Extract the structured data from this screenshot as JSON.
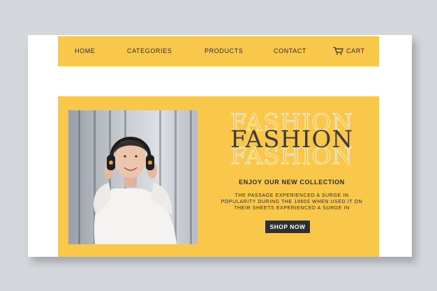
{
  "nav": {
    "home": "HOME",
    "categories": "CATEGORIES",
    "products": "PRODUCTS",
    "contact": "CONTACT",
    "cart": "CART"
  },
  "hero": {
    "title": "FASHION",
    "subtitle": "ENJOY OUR NEW COLLECTION",
    "body": "THE PASSAGE EXPERIENCED A SURGE IN POPULARITY DURING THE 1960S WHEN USED IT ON THEIR SHEETS EXPERIENCED A SURGE IN",
    "cta": "SHOP NOW"
  },
  "colors": {
    "accent": "#f9c74a",
    "dark": "#2f3033",
    "background": "#d3d6db"
  },
  "icons": {
    "cart": "cart-icon"
  }
}
